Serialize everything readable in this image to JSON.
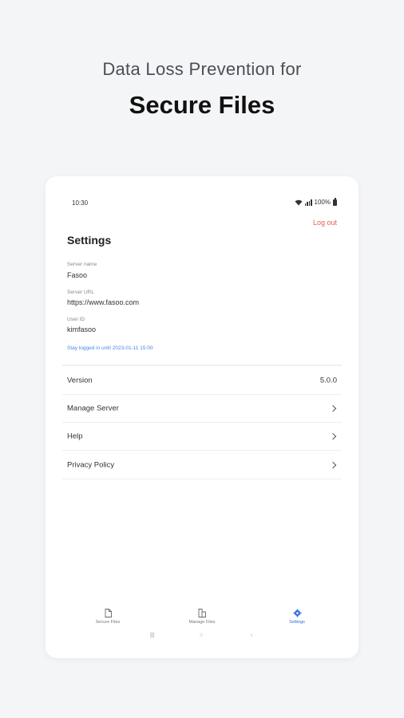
{
  "promo": {
    "headline": "Data Loss Prevention for",
    "headline_strong": "Secure Files"
  },
  "status_bar": {
    "time": "10:30",
    "battery": "100%"
  },
  "header": {
    "logout_label": "Log out",
    "title": "Settings"
  },
  "account": {
    "server_name_label": "Server name",
    "server_name": "Fasoo",
    "server_url_label": "Server URL",
    "server_url": "https://www.fasoo.com",
    "user_id_label": "User ID",
    "user_id": "kimfasoo",
    "stay_logged_in": "Stay logged in until 2023-01-11 15:00"
  },
  "menu": {
    "version_label": "Version",
    "version_value": "5.0.0",
    "manage_server_label": "Manage Server",
    "help_label": "Help",
    "privacy_label": "Privacy Policy"
  },
  "bottom_nav": {
    "items": [
      {
        "label": "Secure Files",
        "icon": "document-icon",
        "active": false
      },
      {
        "label": "Manage Files",
        "icon": "folder-files-icon",
        "active": false
      },
      {
        "label": "Settings",
        "icon": "gear-icon",
        "active": true
      }
    ]
  },
  "colors": {
    "accent": "#2f6fe0",
    "logout": "#e0614f",
    "background": "#f4f5f7"
  }
}
